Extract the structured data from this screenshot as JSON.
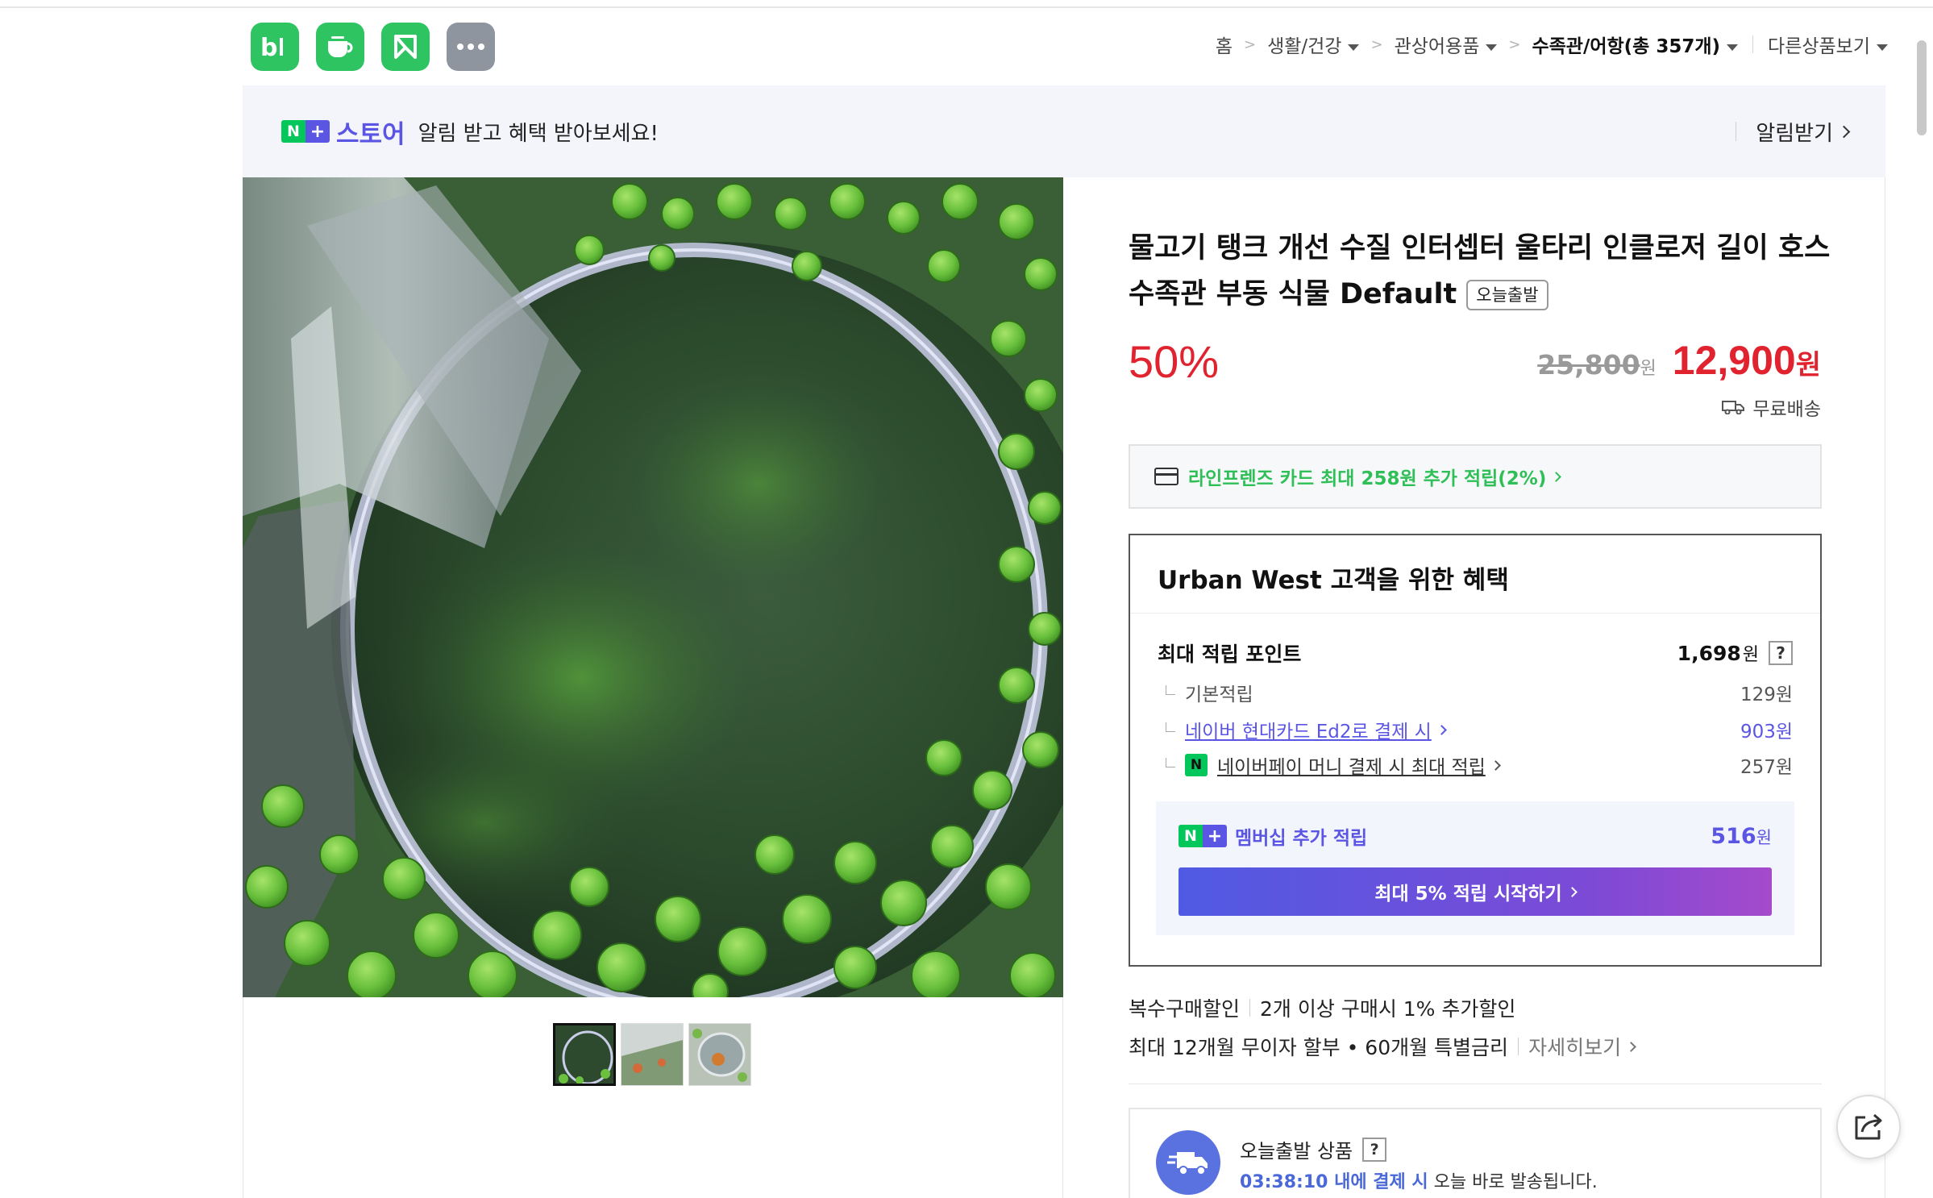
{
  "header": {
    "app_icons": [
      {
        "name": "blog-icon",
        "glyph": "b|"
      },
      {
        "name": "cafe-icon",
        "glyph": "☕"
      },
      {
        "name": "bookmark-icon",
        "glyph": "K"
      },
      {
        "name": "more-icon",
        "glyph": "•••"
      }
    ],
    "breadcrumb": {
      "home": "홈",
      "level1": "생활/건강",
      "level2": "관상어용품",
      "current": "수족관/어항(총 357개)",
      "other": "다른상품보기"
    }
  },
  "banner": {
    "badge_n": "N",
    "badge_plus": "+",
    "store_label": "스토어",
    "text": "알림 받고 혜택 받아보세요!",
    "action": "알림받기"
  },
  "product": {
    "title": "물고기 탱크 개선 수질 인터셉터 울타리 인클로저 길이 호스 수족관 부동 식물 Default",
    "tag": "오늘출발",
    "discount": "50%",
    "original_price": "25,800",
    "original_won": "원",
    "sale_price": "12,900",
    "sale_won": "원",
    "shipping": "무료배송"
  },
  "card_promo": {
    "text": "라인프렌즈 카드 최대 258원 추가 적립(2%)"
  },
  "benefits": {
    "title": "Urban West 고객을 위한 혜택",
    "max_points_label": "최대 적립 포인트",
    "max_points_value": "1,698",
    "won": "원",
    "help": "?",
    "basic_label": "기본적립",
    "basic_value": "129원",
    "hyundai_label": "네이버 현대카드 Ed2로 결제 시",
    "hyundai_value": "903원",
    "naverpay_badge": "N",
    "naverpay_label": "네이버페이 머니 결제 시 최대 적립",
    "naverpay_value": "257원",
    "membership_badge_n": "N",
    "membership_badge_plus": "+",
    "membership_label": "멤버십 추가 적립",
    "membership_value": "516",
    "membership_won": "원",
    "membership_button": "최대 5% 적립 시작하기"
  },
  "extras": {
    "multi_label": "복수구매할인",
    "multi_text": "2개 이상 구매시 1% 추가할인",
    "install_text": "최대 12개월 무이자 할부 • 60개월 특별금리",
    "install_more": "자세히보기"
  },
  "today_ship": {
    "title": "오늘출발 상품",
    "help": "?",
    "time": "03:38:10 내에 결제 시",
    "suffix": " 오늘 바로 발송됩니다."
  },
  "colors": {
    "naver_green": "#03c75a",
    "plus_purple": "#5b55e4",
    "price_red": "#e0232f",
    "promo_green": "#2fbf57"
  }
}
